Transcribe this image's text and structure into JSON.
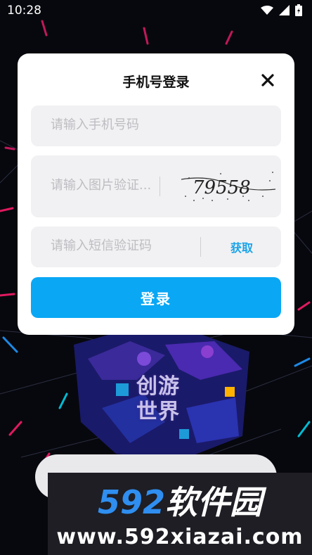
{
  "status_bar": {
    "time": "10:28",
    "icons": [
      "wifi-icon",
      "signal-icon",
      "battery-icon"
    ]
  },
  "game_logo": {
    "line1": "创游",
    "line2": "世界"
  },
  "login_modal": {
    "title": "手机号登录",
    "phone_placeholder": "请输入手机号码",
    "phone_value": "",
    "captcha_placeholder": "请输入图片验证...",
    "captcha_value": "",
    "captcha_image_text": "79558",
    "sms_placeholder": "请输入短信验证码",
    "sms_value": "",
    "get_code_label": "获取",
    "login_label": "登录",
    "accent_color": "#0aa7f5"
  },
  "watermark": {
    "brand_number": "592",
    "brand_text": "软件园",
    "url": "www.592xiazai.com"
  }
}
